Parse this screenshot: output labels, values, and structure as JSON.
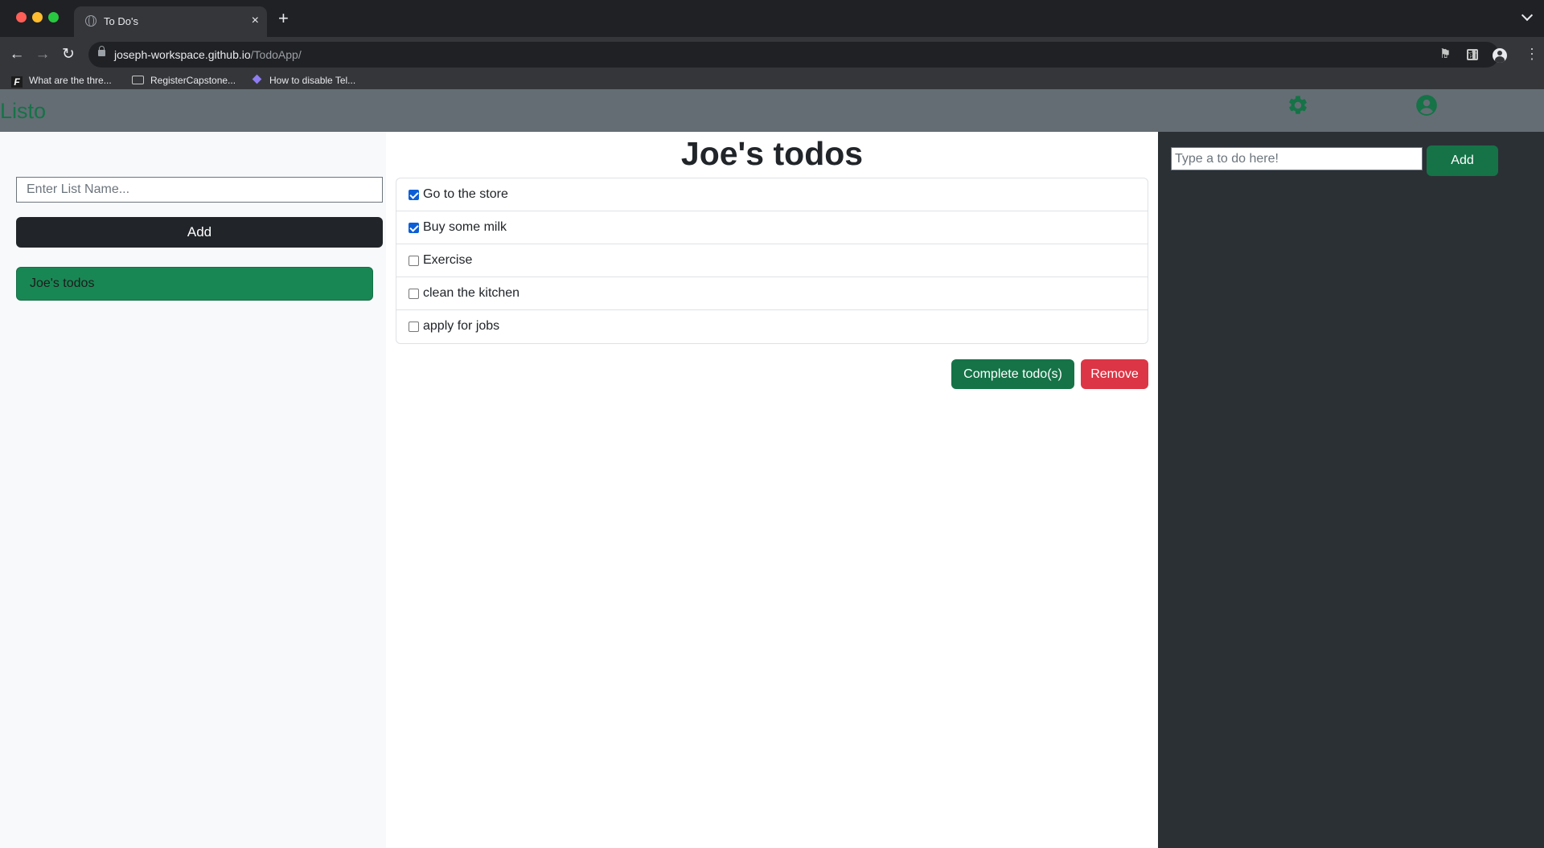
{
  "browser": {
    "tab_title": "To Do's",
    "tab_close": "×",
    "new_tab": "+",
    "url_host": "joseph-workspace.github.io",
    "url_path": "/TodoApp/",
    "bookmarks": [
      {
        "label": "What are the thre...",
        "icon": "f-favicon-icon"
      },
      {
        "label": "RegisterCapstone...",
        "icon": "folder-icon"
      },
      {
        "label": "How to disable Tel...",
        "icon": "gem-favicon-icon"
      }
    ]
  },
  "navbar": {
    "brand": "Listo",
    "brand_color": "#157347",
    "icons": [
      "gear-icon",
      "user-circle-icon"
    ]
  },
  "sidebar": {
    "list_name_placeholder": "Enter List Name...",
    "add_label": "Add",
    "lists": [
      {
        "label": "Joe's todos",
        "color": "#198754"
      }
    ]
  },
  "main": {
    "title": "Joe's todos",
    "todos": [
      {
        "label": "Go to the store",
        "checked": true
      },
      {
        "label": "Buy some milk",
        "checked": true
      },
      {
        "label": "Exercise",
        "checked": false
      },
      {
        "label": "clean the kitchen",
        "checked": false
      },
      {
        "label": "apply for jobs",
        "checked": false
      }
    ],
    "complete_label": "Complete todo(s)",
    "remove_label": "Remove",
    "complete_color": "#157347",
    "remove_color": "#dc3545"
  },
  "right_panel": {
    "todo_placeholder": "Type a to do here!",
    "add_label": "Add"
  }
}
